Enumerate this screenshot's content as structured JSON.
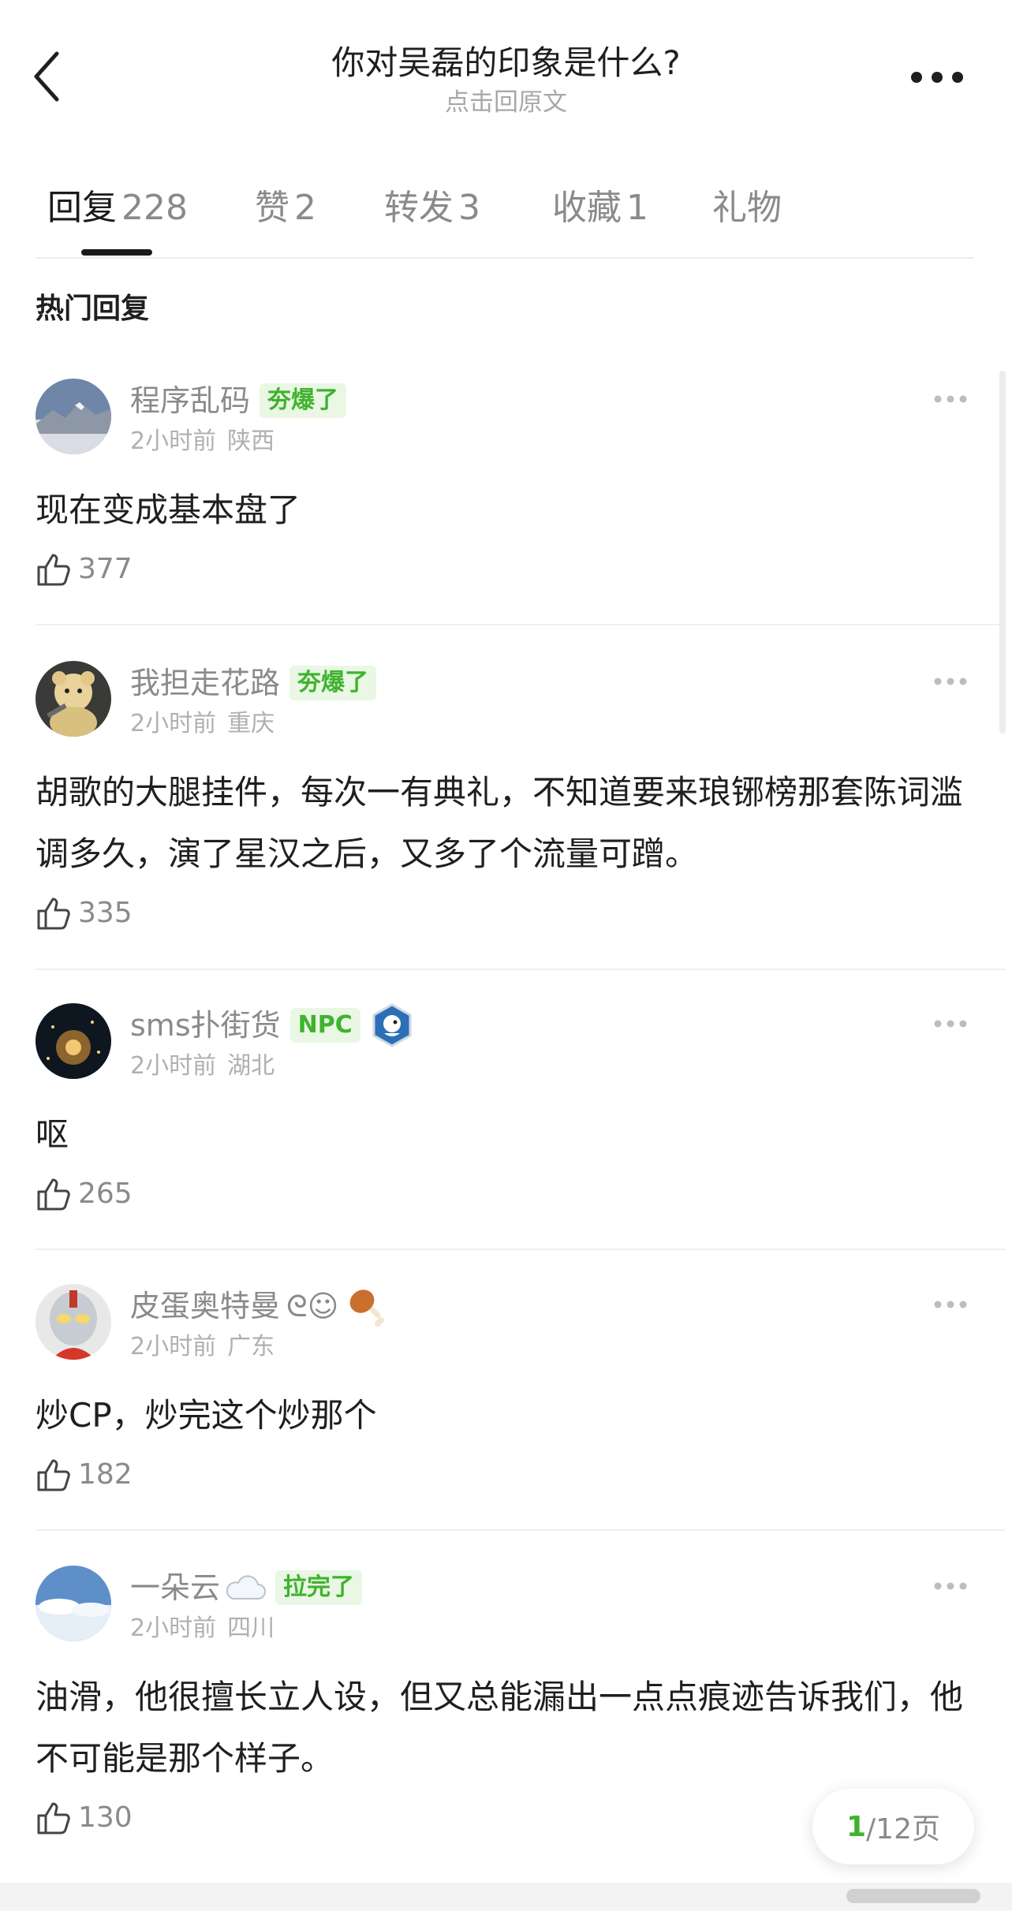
{
  "header": {
    "title": "你对吴磊的印象是什么?",
    "subtitle": "点击回原文",
    "back_icon": "chevron-left-icon",
    "more_icon": "more-horizontal-icon"
  },
  "tabs": [
    {
      "label": "回复",
      "count": "228",
      "active": true
    },
    {
      "label": "赞",
      "count": "2",
      "active": false
    },
    {
      "label": "转发",
      "count": "3",
      "active": false
    },
    {
      "label": "收藏",
      "count": "1",
      "active": false
    },
    {
      "label": "礼物",
      "count": "",
      "active": false
    }
  ],
  "section_title": "热门回复",
  "comments": [
    {
      "user": "程序乱码",
      "badge": "夯爆了",
      "time": "2小时前",
      "location": "陕西",
      "text": "现在变成基本盘了",
      "likes": "377"
    },
    {
      "user": "我担走花路",
      "badge": "夯爆了",
      "time": "2小时前",
      "location": "重庆",
      "text": "胡歌的大腿挂件，每次一有典礼，不知道要来琅铘榜那套陈词滥调多久，演了星汉之后，又多了个流量可蹭。",
      "likes": "335"
    },
    {
      "user": "sms扑街货",
      "badge": "NPC",
      "time": "2小时前",
      "location": "湖北",
      "text": "呕",
      "likes": "265"
    },
    {
      "user": "皮蛋奥特曼",
      "name_suffix": "ᘓ☺",
      "time": "2小时前",
      "location": "广东",
      "text": "炒CP，炒完这个炒那个",
      "likes": "182"
    },
    {
      "user": "一朵云",
      "badge": "拉完了",
      "time": "2小时前",
      "location": "四川",
      "text": "油滑，他很擅长立人设，但又总能漏出一点点痕迹告诉我们，他不可能是那个样子。",
      "likes": "130"
    }
  ],
  "pager": {
    "current": "1",
    "total": "/12页"
  },
  "colors": {
    "accent_green": "#3fb32e",
    "badge_bg": "#e9f7e4",
    "muted_text": "#8a8a8a"
  }
}
